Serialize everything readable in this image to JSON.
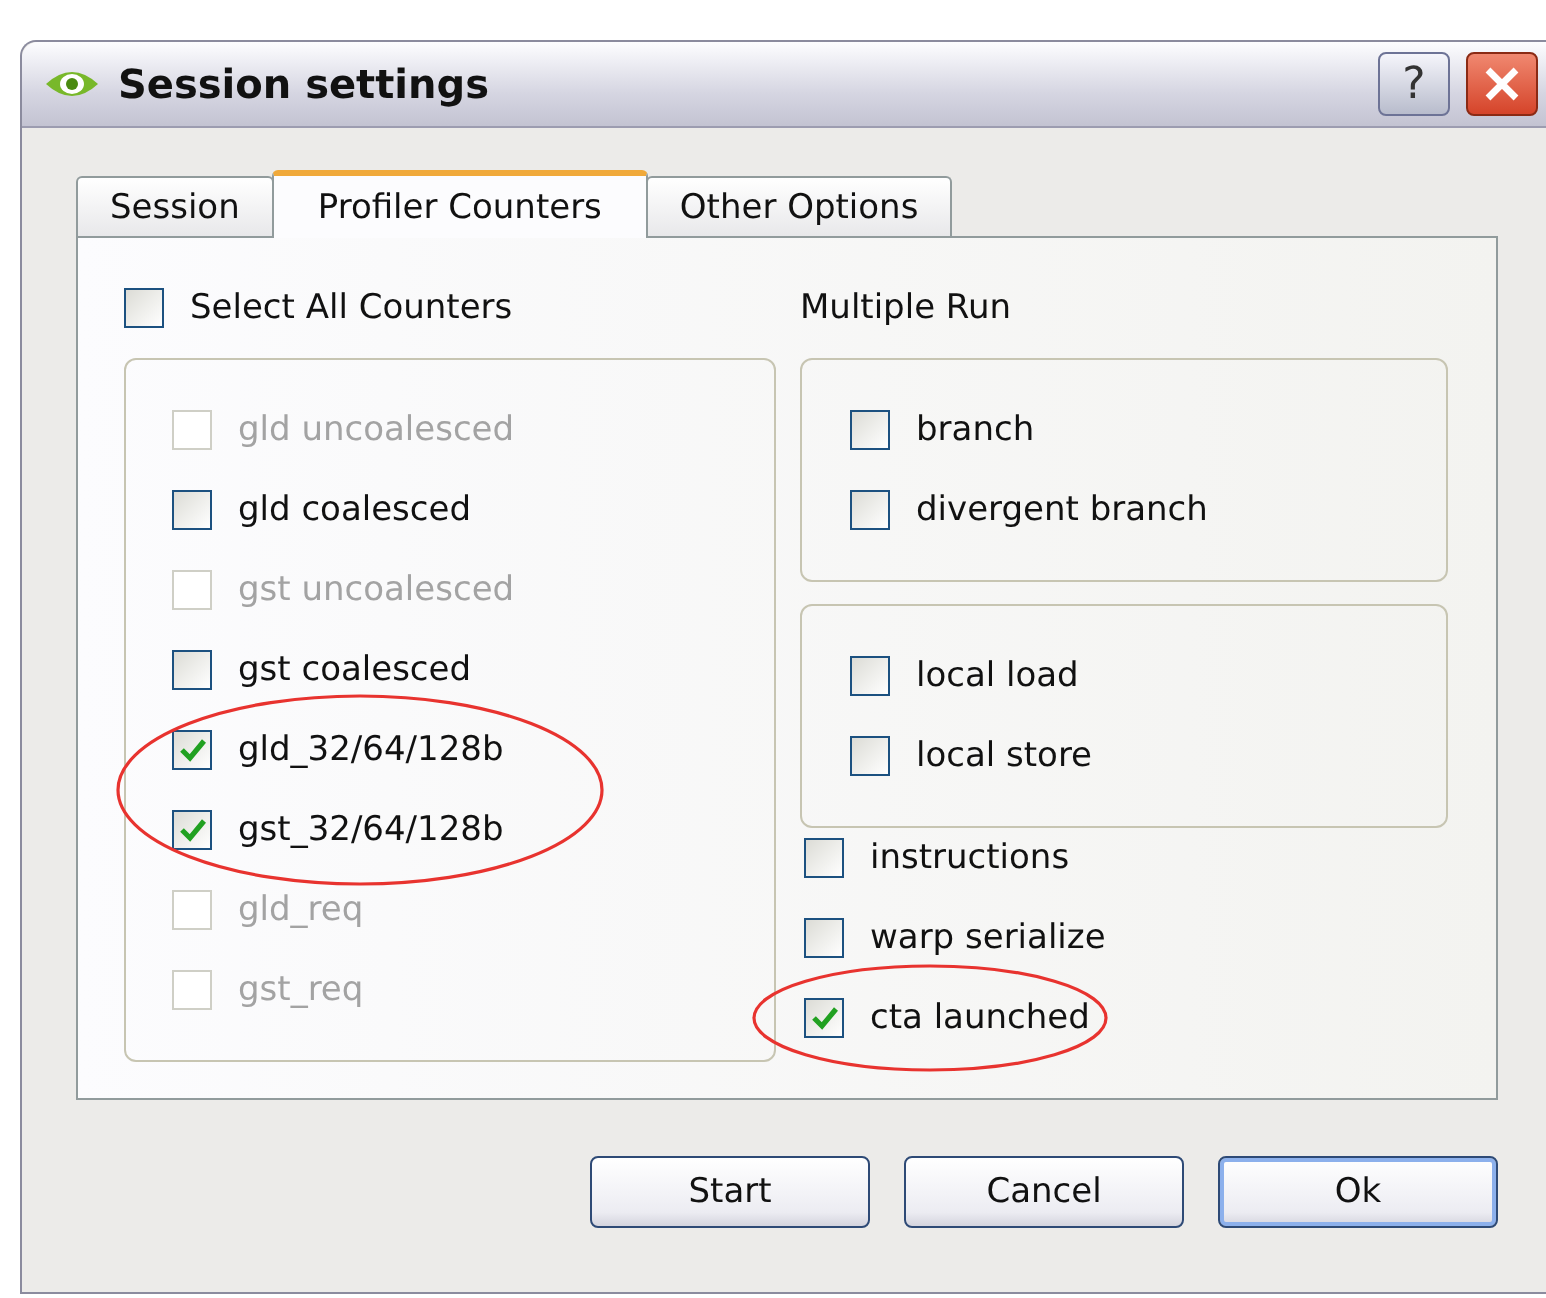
{
  "window": {
    "title": "Session settings",
    "help_label": "?"
  },
  "tabs": [
    {
      "label": "Session",
      "selected": false
    },
    {
      "label": "Profiler Counters",
      "selected": true
    },
    {
      "label": "Other Options",
      "selected": false
    }
  ],
  "select_all": {
    "label": "Select All Counters",
    "checked": false
  },
  "left_items": [
    {
      "label": "gld uncoalesced",
      "checked": false,
      "disabled": true,
      "circled": false
    },
    {
      "label": "gld coalesced",
      "checked": false,
      "disabled": false,
      "circled": false
    },
    {
      "label": "gst uncoalesced",
      "checked": false,
      "disabled": true,
      "circled": false
    },
    {
      "label": "gst coalesced",
      "checked": false,
      "disabled": false,
      "circled": false
    },
    {
      "label": "gld_32/64/128b",
      "checked": true,
      "disabled": false,
      "circled": true
    },
    {
      "label": "gst_32/64/128b",
      "checked": true,
      "disabled": false,
      "circled": true
    },
    {
      "label": "gld_req",
      "checked": false,
      "disabled": true,
      "circled": false
    },
    {
      "label": "gst_req",
      "checked": false,
      "disabled": true,
      "circled": false
    }
  ],
  "multiple_run": {
    "heading": "Multiple Run",
    "groups": [
      [
        {
          "label": "branch",
          "checked": false,
          "disabled": false,
          "circled": false
        },
        {
          "label": "divergent branch",
          "checked": false,
          "disabled": false,
          "circled": false
        }
      ],
      [
        {
          "label": "local load",
          "checked": false,
          "disabled": false,
          "circled": false
        },
        {
          "label": "local store",
          "checked": false,
          "disabled": false,
          "circled": false
        }
      ]
    ],
    "items": [
      {
        "label": "instructions",
        "checked": false,
        "disabled": false,
        "circled": false
      },
      {
        "label": "warp serialize",
        "checked": false,
        "disabled": false,
        "circled": false
      },
      {
        "label": "cta launched",
        "checked": true,
        "disabled": false,
        "circled": true
      }
    ]
  },
  "buttons": [
    {
      "label": "Start",
      "default": false
    },
    {
      "label": "Cancel",
      "default": false
    },
    {
      "label": "Ok",
      "default": true
    }
  ]
}
